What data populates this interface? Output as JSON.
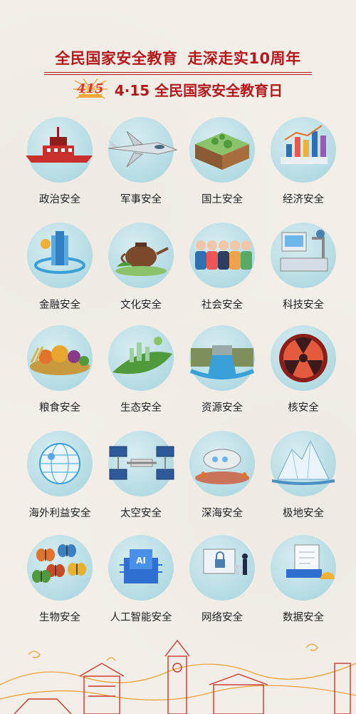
{
  "header": {
    "title_part1": "全民国家安全教育",
    "title_part2": "走深走实10周年",
    "logo_text": "415",
    "subtitle": "4·15 全民国家安全教育日"
  },
  "items": [
    {
      "label": "政治安全",
      "icon": "red-boat-icon"
    },
    {
      "label": "军事安全",
      "icon": "fighter-jet-icon"
    },
    {
      "label": "国土安全",
      "icon": "land-block-icon"
    },
    {
      "label": "经济安全",
      "icon": "bar-chart-icon"
    },
    {
      "label": "金融安全",
      "icon": "finance-building-icon"
    },
    {
      "label": "文化安全",
      "icon": "teapot-icon"
    },
    {
      "label": "社会安全",
      "icon": "people-group-icon"
    },
    {
      "label": "科技安全",
      "icon": "lab-machine-icon"
    },
    {
      "label": "粮食安全",
      "icon": "harvest-icon"
    },
    {
      "label": "生态安全",
      "icon": "green-city-leaf-icon"
    },
    {
      "label": "资源安全",
      "icon": "water-dam-icon"
    },
    {
      "label": "核安全",
      "icon": "radiation-icon"
    },
    {
      "label": "海外利益安全",
      "icon": "globe-icon"
    },
    {
      "label": "太空安全",
      "icon": "space-station-icon"
    },
    {
      "label": "深海安全",
      "icon": "submarine-icon"
    },
    {
      "label": "极地安全",
      "icon": "iceberg-icon"
    },
    {
      "label": "生物安全",
      "icon": "butterflies-icon"
    },
    {
      "label": "人工智能安全",
      "icon": "ai-chip-icon"
    },
    {
      "label": "网络安全",
      "icon": "network-lock-icon"
    },
    {
      "label": "数据安全",
      "icon": "data-documents-icon"
    }
  ],
  "colors": {
    "brand_red": "#b5171b",
    "circle_blue": "#b4dbe3",
    "background": "#f3efe8"
  }
}
